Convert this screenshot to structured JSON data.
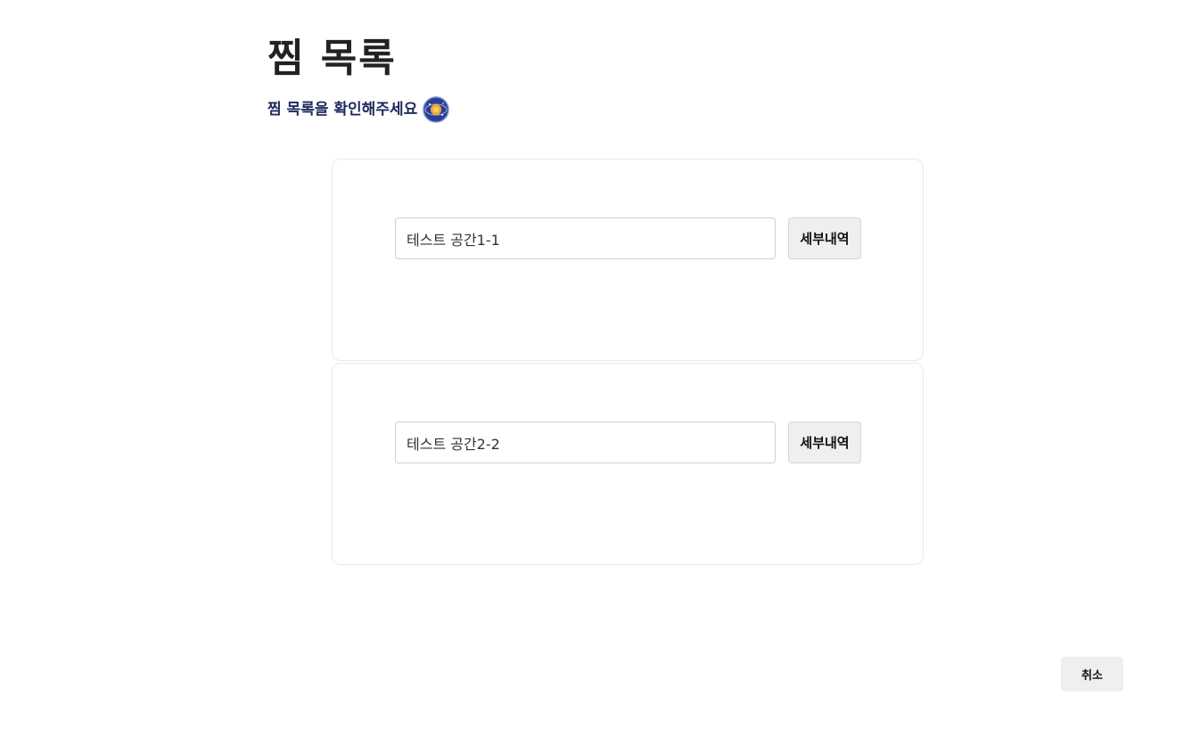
{
  "header": {
    "title": "찜 목록",
    "subtitle": "찜 목록을 확인해주세요"
  },
  "icons": {
    "subtitle_icon": "globe-icon"
  },
  "wishlist": {
    "items": [
      {
        "value": "테스트 공간1-1",
        "detail_label": "세부내역"
      },
      {
        "value": "테스트 공간2-2",
        "detail_label": "세부내역"
      }
    ]
  },
  "footer": {
    "cancel_label": "취소"
  },
  "colors": {
    "title": "#222222",
    "subtitle": "#1f2a5c",
    "button_bg": "#efefef",
    "card_border": "#e9e9e9"
  }
}
